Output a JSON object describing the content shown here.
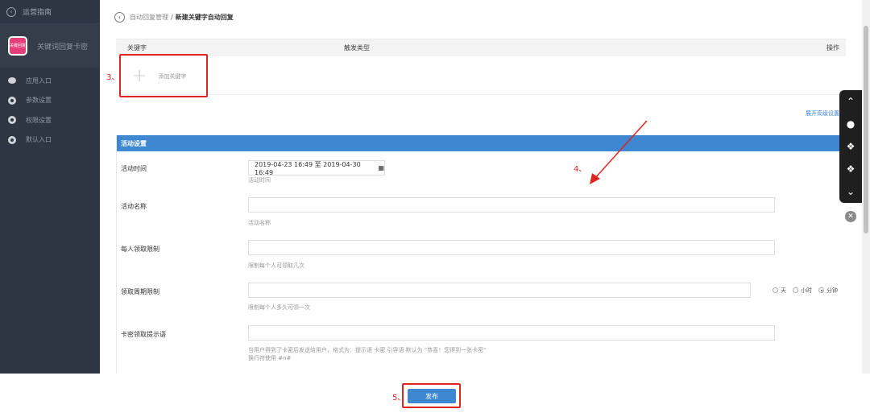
{
  "sidebar": {
    "top_label": "运营指南",
    "app_logo_text": "关键回复",
    "app_name": "关键词回复卡密",
    "items": [
      {
        "label": "应用入口",
        "icon": "chat-bubble-icon"
      },
      {
        "label": "参数设置",
        "icon": "gear-icon"
      },
      {
        "label": "权限设置",
        "icon": "gear-icon"
      },
      {
        "label": "默认入口",
        "icon": "gear-icon"
      }
    ]
  },
  "breadcrumb": {
    "parent": "自动回复管理",
    "separator": "/",
    "current": "新建关键字自动回复"
  },
  "keyword_table": {
    "columns": [
      "关键字",
      "触发类型",
      "操作"
    ],
    "add_label": "添加关键字"
  },
  "expand_link": "展开高级设置",
  "activity": {
    "header": "活动设置",
    "fields": [
      {
        "label": "活动时间",
        "value": "2019-04-23 16:49 至 2019-04-30 16:49",
        "hint": "活动时间"
      },
      {
        "label": "活动名称",
        "value": "",
        "hint": "活动名称"
      },
      {
        "label": "每人领取限制",
        "value": "",
        "hint": "限制每个人可领取几次"
      },
      {
        "label": "领取周期限制",
        "value": "",
        "hint": "限制每个人多久可领一次"
      },
      {
        "label": "卡密领取提示语",
        "value": "",
        "hint": "当用户得到了卡密后发送给用户，格式为：提示语 卡密 引导语 默认为 \"恭喜！您得到一张卡密\"",
        "hint2": "换行符使用 #n#"
      }
    ],
    "period_options": [
      {
        "label": "天",
        "selected": false
      },
      {
        "label": "小时",
        "selected": false
      },
      {
        "label": "分钟",
        "selected": true
      }
    ]
  },
  "publish_button": "发布",
  "annotations": {
    "step3": "3、",
    "step4": "4、",
    "step5": "5、",
    "color": "#e0241f"
  },
  "colors": {
    "sidebar_bg": "#2f3643",
    "primary": "#3d88d1"
  }
}
